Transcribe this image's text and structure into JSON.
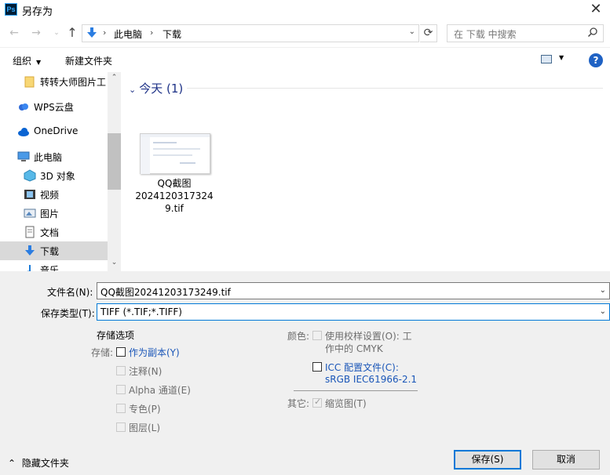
{
  "window": {
    "app_icon_text": "Ps",
    "title": "另存为",
    "close_glyph": "✕"
  },
  "nav": {
    "back": "←",
    "forward": "→",
    "recent": "⌄",
    "up": "↑",
    "path": [
      "此电脑",
      "下载"
    ],
    "separator": "›",
    "dropdown": "⌄",
    "refresh": "⟳",
    "search_placeholder": "在 下载 中搜索"
  },
  "toolbar": {
    "organize_label": "组织",
    "new_folder_label": "新建文件夹",
    "dropdown_glyph": "▼",
    "help_label": "?"
  },
  "sidebar": {
    "items": [
      {
        "label": "转转大师图片工",
        "icon": "folder-icon"
      },
      {
        "label": "WPS云盘",
        "icon": "cloud-icon"
      },
      {
        "label": "OneDrive",
        "icon": "onedrive-icon"
      },
      {
        "label": "此电脑",
        "icon": "computer-icon"
      },
      {
        "label": "3D 对象",
        "icon": "cube-icon"
      },
      {
        "label": "视频",
        "icon": "video-icon"
      },
      {
        "label": "图片",
        "icon": "picture-icon"
      },
      {
        "label": "文档",
        "icon": "document-icon"
      },
      {
        "label": "下载",
        "icon": "download-icon",
        "selected": true
      },
      {
        "label": "音乐",
        "icon": "music-icon"
      }
    ],
    "scroll_up": "⌃",
    "scroll_down": "⌄"
  },
  "content": {
    "group_chevron": "⌄",
    "group_label": "今天 (1)",
    "files": [
      {
        "name_line1": "QQ截图",
        "name_line2": "2024120317324",
        "name_line3": "9.tif"
      }
    ]
  },
  "form": {
    "filename_label": "文件名(N):",
    "filename_value": "QQ截图20241203173249.tif",
    "filetype_label": "保存类型(T):",
    "filetype_value": "TIFF (*.TIF;*.TIFF)",
    "dropdown_glyph": "⌄"
  },
  "options": {
    "title": "存储选项",
    "store_label": "存储:",
    "as_copy": "作为副本(Y)",
    "notes": "注释(N)",
    "alpha": "Alpha 通道(E)",
    "spot": "专色(P)",
    "layers": "图层(L)",
    "color_label": "颜色:",
    "proof_line1": "使用校样设置(O): 工",
    "proof_line2": "作中的 CMYK",
    "icc_line1": "ICC 配置文件(C):",
    "icc_line2": "sRGB IEC61966-2.1",
    "other_label": "其它:",
    "thumbnail": "缩览图(T)",
    "check_glyph": "✓"
  },
  "footer": {
    "hide_chevron": "⌃",
    "hide_folders": "隐藏文件夹",
    "save_label": "保存(S)",
    "cancel_label": "取消"
  },
  "colors": {
    "accent": "#0078d7",
    "link_blue": "#1a56b8",
    "group_header": "#1e3287",
    "panel_bg": "#f0f0f0"
  }
}
